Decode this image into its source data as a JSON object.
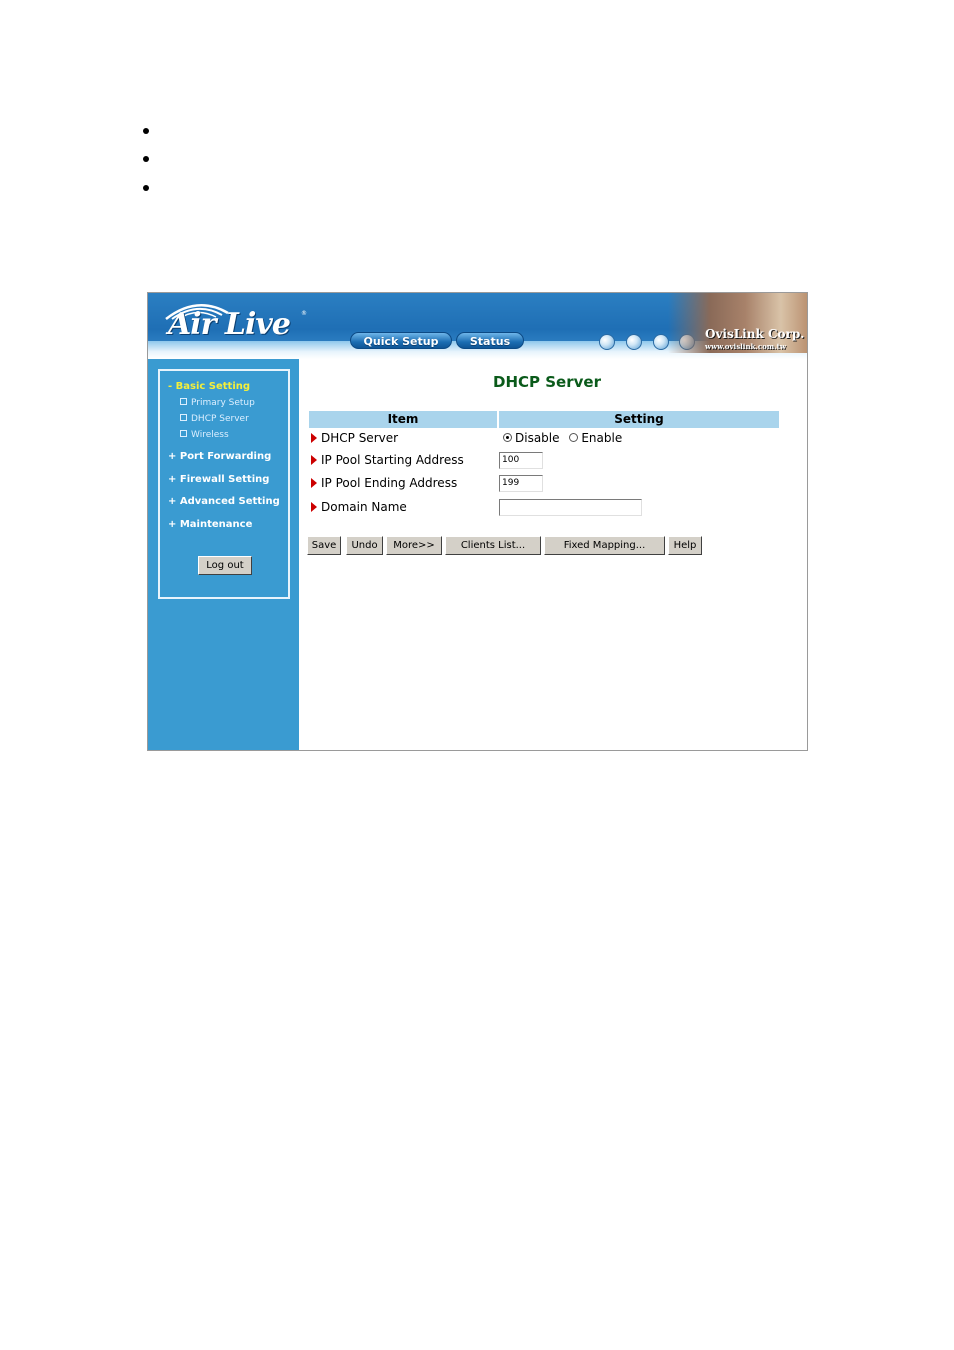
{
  "header": {
    "logo_text": "Air Live",
    "logo_reg": "®",
    "buttons": [
      "Quick Setup",
      "Status"
    ],
    "globe_icons": [
      "globe-icon",
      "globe-icon",
      "globe-icon",
      "globe-icon"
    ],
    "corp_name": "OvisLink Corp.",
    "corp_url": "www.ovislink.com.tw"
  },
  "sidebar": {
    "active_section": "- Basic Setting",
    "sub_items": [
      "Primary Setup",
      "DHCP Server",
      "Wireless"
    ],
    "sections": [
      "+ Port Forwarding",
      "+ Firewall Setting",
      "+ Advanced Setting",
      "+ Maintenance"
    ],
    "logout_label": "Log out"
  },
  "main": {
    "title": "DHCP Server",
    "columns": [
      "Item",
      "Setting"
    ],
    "rows": {
      "dhcp_server": {
        "label": "DHCP Server",
        "options": [
          "Disable",
          "Enable"
        ],
        "selected": "Disable"
      },
      "pool_start": {
        "label": "IP Pool Starting Address",
        "value": "100"
      },
      "pool_end": {
        "label": "IP Pool Ending Address",
        "value": "199"
      },
      "domain": {
        "label": "Domain Name",
        "value": ""
      }
    },
    "buttons": [
      "Save",
      "Undo",
      "More>>",
      "Clients List...",
      "Fixed Mapping...",
      "Help"
    ]
  },
  "colors": {
    "sidebar_bg": "#3a9bd1",
    "active_menu": "#f5ef3a",
    "title": "#0a5a1a",
    "table_header": "#a9d4ec",
    "arrow": "#cc0000"
  }
}
